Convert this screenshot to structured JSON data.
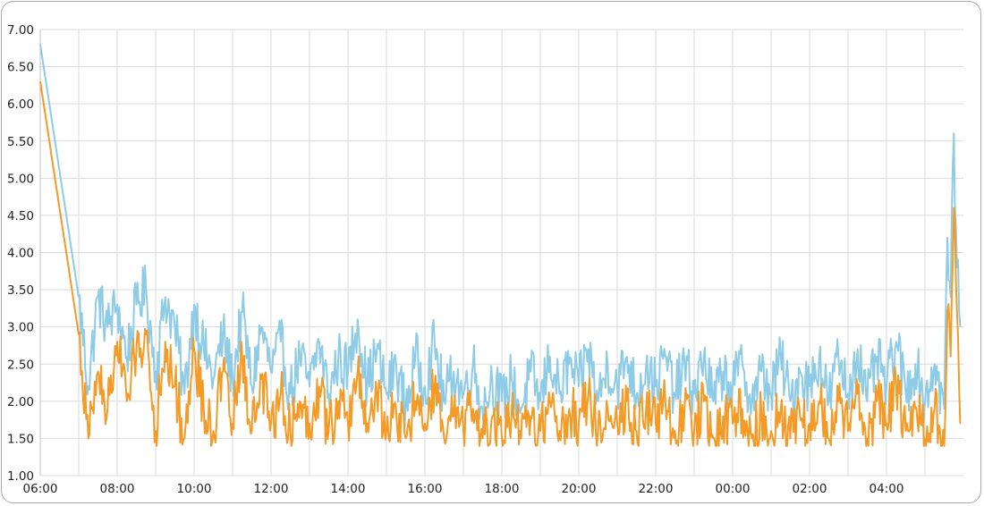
{
  "chart_data": {
    "type": "line",
    "title": "",
    "xlabel": "",
    "ylabel": "",
    "ylim": [
      1.0,
      7.0
    ],
    "xlim": [
      "06:00",
      "06:00 (+1 day)"
    ],
    "grid": true,
    "legend": "none",
    "y_ticks": [
      "1.00",
      "1.50",
      "2.00",
      "2.50",
      "3.00",
      "3.50",
      "4.00",
      "4.50",
      "5.00",
      "5.50",
      "6.00",
      "6.50",
      "7.00"
    ],
    "x_ticks": [
      "06:00",
      "08:00",
      "10:00",
      "12:00",
      "14:00",
      "16:00",
      "18:00",
      "20:00",
      "22:00",
      "00:00",
      "02:00",
      "04:00"
    ],
    "x_tick_hours": [
      0,
      2,
      4,
      6,
      8,
      10,
      12,
      14,
      16,
      18,
      20,
      22
    ],
    "hour_gridlines": [
      1,
      3,
      5,
      7,
      9,
      11,
      13,
      15,
      17,
      19,
      21,
      23
    ],
    "series": [
      {
        "color": "#8ecbe6",
        "points": [
          [
            "06:00",
            6.8
          ],
          [
            "07:00",
            3.4
          ],
          [
            "07:15",
            2.2
          ],
          [
            "07:30",
            3.4
          ],
          [
            "07:45",
            3.0
          ],
          [
            "08:00",
            3.3
          ],
          [
            "08:15",
            2.6
          ],
          [
            "08:30",
            3.3
          ],
          [
            "08:45",
            3.5
          ],
          [
            "09:00",
            2.4
          ],
          [
            "09:15",
            3.4
          ],
          [
            "09:30",
            3.0
          ],
          [
            "09:45",
            2.1
          ],
          [
            "10:00",
            3.3
          ],
          [
            "10:15",
            2.7
          ],
          [
            "10:30",
            2.3
          ],
          [
            "10:45",
            2.9
          ],
          [
            "11:00",
            2.3
          ],
          [
            "11:15",
            3.2
          ],
          [
            "11:30",
            2.2
          ],
          [
            "11:45",
            3.0
          ],
          [
            "12:00",
            2.4
          ],
          [
            "12:15",
            2.8
          ],
          [
            "12:30",
            2.1
          ],
          [
            "12:45",
            2.6
          ],
          [
            "13:00",
            2.2
          ],
          [
            "13:15",
            2.8
          ],
          [
            "13:30",
            2.1
          ],
          [
            "13:45",
            2.6
          ],
          [
            "14:00",
            2.4
          ],
          [
            "14:15",
            3.1
          ],
          [
            "14:30",
            2.2
          ],
          [
            "14:45",
            2.7
          ],
          [
            "15:00",
            2.1
          ],
          [
            "15:15",
            2.5
          ],
          [
            "15:30",
            1.9
          ],
          [
            "15:45",
            2.6
          ],
          [
            "16:00",
            2.2
          ],
          [
            "16:15",
            2.8
          ],
          [
            "16:30",
            2.0
          ],
          [
            "16:45",
            2.4
          ],
          [
            "17:00",
            2.1
          ],
          [
            "17:15",
            2.5
          ],
          [
            "17:30",
            1.9
          ],
          [
            "17:45",
            2.3
          ],
          [
            "18:00",
            2.0
          ],
          [
            "18:15",
            2.3
          ],
          [
            "18:30",
            1.9
          ],
          [
            "18:45",
            2.4
          ],
          [
            "19:00",
            2.0
          ],
          [
            "19:15",
            2.6
          ],
          [
            "19:30",
            2.1
          ],
          [
            "19:45",
            2.5
          ],
          [
            "20:00",
            2.2
          ],
          [
            "20:15",
            2.7
          ],
          [
            "20:30",
            2.0
          ],
          [
            "20:45",
            2.5
          ],
          [
            "21:00",
            2.2
          ],
          [
            "21:15",
            2.6
          ],
          [
            "21:30",
            2.1
          ],
          [
            "21:45",
            2.5
          ],
          [
            "22:00",
            2.2
          ],
          [
            "22:15",
            2.6
          ],
          [
            "22:30",
            2.1
          ],
          [
            "22:45",
            2.5
          ],
          [
            "23:00",
            2.1
          ],
          [
            "23:15",
            2.6
          ],
          [
            "23:30",
            2.0
          ],
          [
            "23:45",
            2.4
          ],
          [
            "00:00",
            2.2
          ],
          [
            "00:15",
            2.5
          ],
          [
            "00:30",
            2.0
          ],
          [
            "00:45",
            2.4
          ],
          [
            "01:00",
            2.1
          ],
          [
            "01:15",
            2.6
          ],
          [
            "01:30",
            2.0
          ],
          [
            "01:45",
            2.4
          ],
          [
            "02:00",
            2.2
          ],
          [
            "02:15",
            2.6
          ],
          [
            "02:30",
            2.0
          ],
          [
            "02:45",
            2.6
          ],
          [
            "03:00",
            2.1
          ],
          [
            "03:15",
            2.7
          ],
          [
            "03:30",
            2.0
          ],
          [
            "03:45",
            2.6
          ],
          [
            "04:00",
            2.2
          ],
          [
            "04:15",
            2.8
          ],
          [
            "04:30",
            2.1
          ],
          [
            "04:45",
            2.5
          ],
          [
            "05:00",
            2.0
          ],
          [
            "05:15",
            2.5
          ],
          [
            "05:30",
            1.9
          ],
          [
            "05:35",
            4.2
          ],
          [
            "05:40",
            3.4
          ],
          [
            "05:45",
            5.6
          ],
          [
            "05:50",
            3.8
          ],
          [
            "05:55",
            3.0
          ]
        ]
      },
      {
        "color": "#f39a27",
        "points": [
          [
            "06:00",
            6.3
          ],
          [
            "07:00",
            2.9
          ],
          [
            "07:15",
            1.5
          ],
          [
            "07:30",
            2.4
          ],
          [
            "07:45",
            1.9
          ],
          [
            "08:00",
            2.8
          ],
          [
            "08:15",
            2.0
          ],
          [
            "08:30",
            2.7
          ],
          [
            "08:45",
            2.9
          ],
          [
            "09:00",
            1.6
          ],
          [
            "09:15",
            2.8
          ],
          [
            "09:30",
            2.2
          ],
          [
            "09:45",
            1.5
          ],
          [
            "10:00",
            2.7
          ],
          [
            "10:15",
            1.9
          ],
          [
            "10:30",
            1.6
          ],
          [
            "10:45",
            2.4
          ],
          [
            "11:00",
            1.7
          ],
          [
            "11:15",
            2.6
          ],
          [
            "11:30",
            1.6
          ],
          [
            "11:45",
            2.3
          ],
          [
            "12:00",
            1.7
          ],
          [
            "12:15",
            2.1
          ],
          [
            "12:30",
            1.6
          ],
          [
            "12:45",
            2.0
          ],
          [
            "13:00",
            1.7
          ],
          [
            "13:15",
            2.2
          ],
          [
            "13:30",
            1.6
          ],
          [
            "13:45",
            2.0
          ],
          [
            "14:00",
            1.7
          ],
          [
            "14:15",
            2.4
          ],
          [
            "14:30",
            1.7
          ],
          [
            "14:45",
            2.1
          ],
          [
            "15:00",
            1.6
          ],
          [
            "15:15",
            1.9
          ],
          [
            "15:30",
            1.5
          ],
          [
            "15:45",
            2.0
          ],
          [
            "16:00",
            1.7
          ],
          [
            "16:15",
            2.2
          ],
          [
            "16:30",
            1.5
          ],
          [
            "16:45",
            1.8
          ],
          [
            "17:00",
            1.6
          ],
          [
            "17:15",
            1.9
          ],
          [
            "17:30",
            1.5
          ],
          [
            "17:45",
            1.8
          ],
          [
            "18:00",
            1.5
          ],
          [
            "18:15",
            1.8
          ],
          [
            "18:30",
            1.5
          ],
          [
            "18:45",
            1.8
          ],
          [
            "19:00",
            1.6
          ],
          [
            "19:15",
            2.0
          ],
          [
            "19:30",
            1.6
          ],
          [
            "19:45",
            1.9
          ],
          [
            "20:00",
            1.7
          ],
          [
            "20:15",
            2.1
          ],
          [
            "20:30",
            1.6
          ],
          [
            "20:45",
            1.9
          ],
          [
            "21:00",
            1.7
          ],
          [
            "21:15",
            2.0
          ],
          [
            "21:30",
            1.6
          ],
          [
            "21:45",
            1.9
          ],
          [
            "22:00",
            1.7
          ],
          [
            "22:15",
            2.0
          ],
          [
            "22:30",
            1.6
          ],
          [
            "22:45",
            1.9
          ],
          [
            "23:00",
            1.6
          ],
          [
            "23:15",
            2.0
          ],
          [
            "23:30",
            1.5
          ],
          [
            "23:45",
            1.8
          ],
          [
            "00:00",
            1.7
          ],
          [
            "00:15",
            1.9
          ],
          [
            "00:30",
            1.5
          ],
          [
            "00:45",
            1.8
          ],
          [
            "01:00",
            1.6
          ],
          [
            "01:15",
            1.9
          ],
          [
            "01:30",
            1.5
          ],
          [
            "01:45",
            1.8
          ],
          [
            "02:00",
            1.7
          ],
          [
            "02:15",
            2.0
          ],
          [
            "02:30",
            1.5
          ],
          [
            "02:45",
            2.0
          ],
          [
            "03:00",
            1.6
          ],
          [
            "03:15",
            2.1
          ],
          [
            "03:30",
            1.5
          ],
          [
            "03:45",
            2.0
          ],
          [
            "04:00",
            1.7
          ],
          [
            "04:15",
            2.2
          ],
          [
            "04:30",
            1.6
          ],
          [
            "04:45",
            1.9
          ],
          [
            "05:00",
            1.5
          ],
          [
            "05:15",
            1.9
          ],
          [
            "05:30",
            1.4
          ],
          [
            "05:35",
            3.2
          ],
          [
            "05:40",
            2.6
          ],
          [
            "05:45",
            4.6
          ],
          [
            "05:50",
            3.2
          ],
          [
            "05:55",
            1.7
          ]
        ]
      }
    ]
  }
}
